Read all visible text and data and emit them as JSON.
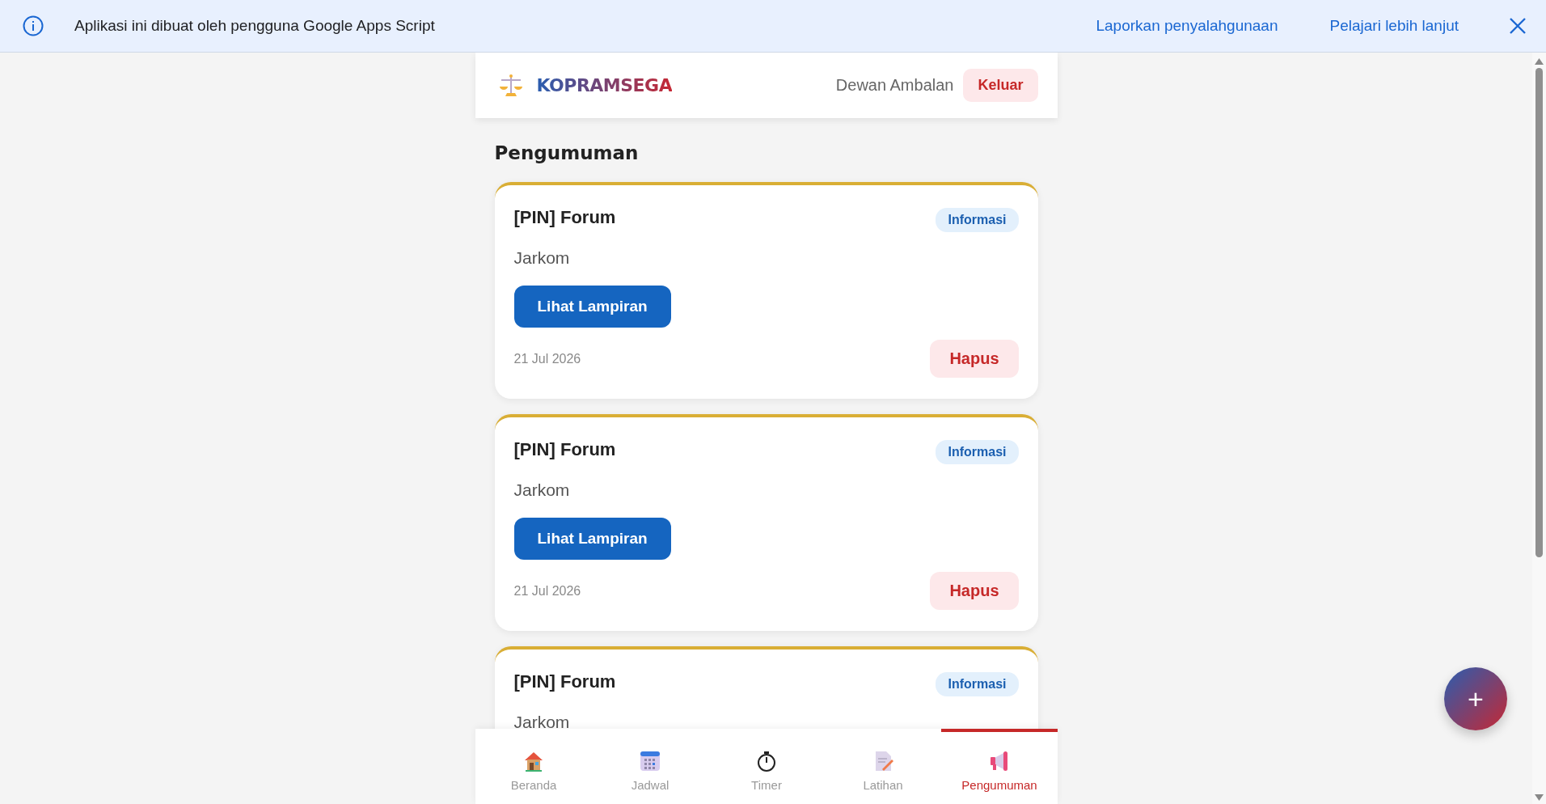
{
  "banner": {
    "message": "Aplikasi ini dibuat oleh pengguna Google Apps Script",
    "links": [
      "Laporkan penyalahgunaan",
      "Pelajari lebih lanjut"
    ]
  },
  "header": {
    "brand": "KOPRAMSEGA",
    "user": "Dewan Ambalan",
    "logout": "Keluar"
  },
  "page_title": "Pengumuman",
  "announcements": [
    {
      "title": "[PIN] Forum",
      "tag": "Informasi",
      "body": "Jarkom",
      "attachment": "Lihat Lampiran",
      "date": "21 Jul 2026",
      "delete": "Hapus"
    },
    {
      "title": "[PIN] Forum",
      "tag": "Informasi",
      "body": "Jarkom",
      "attachment": "Lihat Lampiran",
      "date": "21 Jul 2026",
      "delete": "Hapus"
    },
    {
      "title": "[PIN] Forum",
      "tag": "Informasi",
      "body": "Jarkom"
    }
  ],
  "fab": "+",
  "nav": [
    {
      "kind": "home",
      "label": "Beranda",
      "selected": false
    },
    {
      "kind": "calendar",
      "label": "Jadwal",
      "selected": false
    },
    {
      "kind": "timer",
      "label": "Timer",
      "selected": false
    },
    {
      "kind": "practice",
      "label": "Latihan",
      "selected": false
    },
    {
      "kind": "announce",
      "label": "Pengumuman",
      "selected": true
    }
  ]
}
